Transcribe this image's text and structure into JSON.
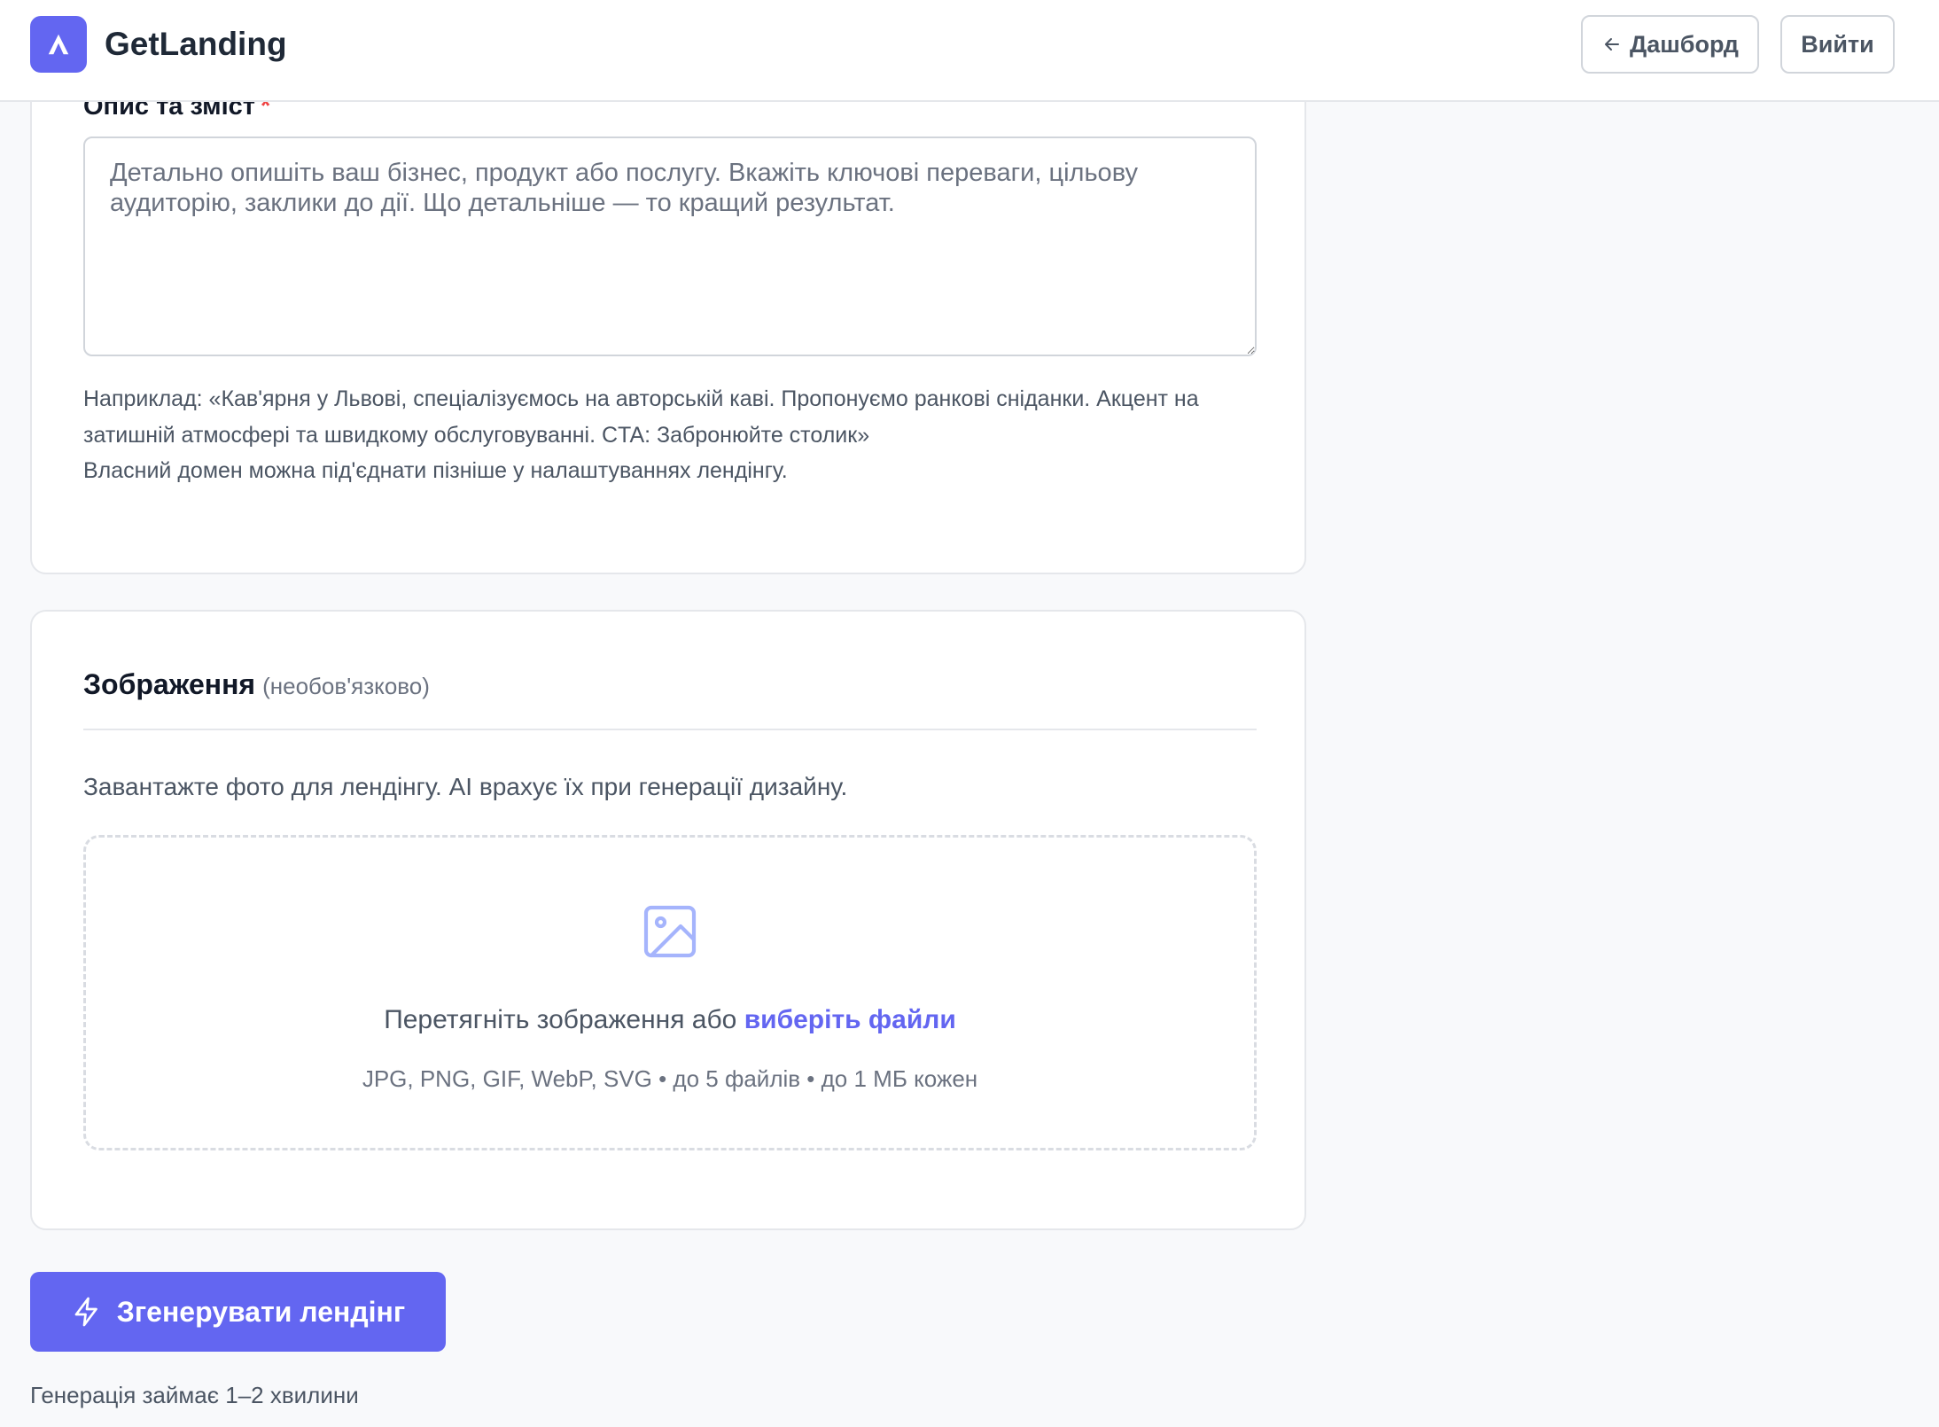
{
  "header": {
    "brand": "GetLanding",
    "dashboard_label": "Дашборд",
    "logout_label": "Вийти"
  },
  "description_card": {
    "label": "Опис та зміст",
    "required_mark": "*",
    "placeholder": "Детально опишіть ваш бізнес, продукт або послугу. Вкажіть ключові переваги, цільову аудиторію, заклики до дії. Що детальніше — то кращий результат.",
    "example_hint": "Наприклад: «Кав'ярня у Львові, спеціалізуємось на авторській каві. Пропонуємо ранкові сніданки. Акцент на затишній атмосфері та швидкому обслуговуванні. CTA: Забронюйте столик»",
    "domain_hint": "Власний домен можна під'єднати пізніше у налаштуваннях лендінгу."
  },
  "images_card": {
    "title": "Зображення",
    "subtitle": "(необов'язково)",
    "description": "Завантажте фото для лендінгу. AI врахує їх при генерації дизайну.",
    "dropzone_text": "Перетягніть зображення або",
    "dropzone_link": "виберіть файли",
    "dropzone_formats": "JPG, PNG, GIF, WebP, SVG • до 5 файлів • до 1 МБ кожен"
  },
  "actions": {
    "generate_label": "Згенерувати лендінг",
    "generate_note": "Генерація займає 1–2 хвилини"
  },
  "icons": {
    "logo": "arrow-up-logo-icon",
    "back": "arrow-left-icon",
    "image": "image-icon",
    "generate": "lightning-icon"
  },
  "colors": {
    "accent": "#6366f1",
    "required": "#ef4444",
    "background": "#f8f9fb",
    "card": "#ffffff",
    "border": "#e5e7eb"
  }
}
